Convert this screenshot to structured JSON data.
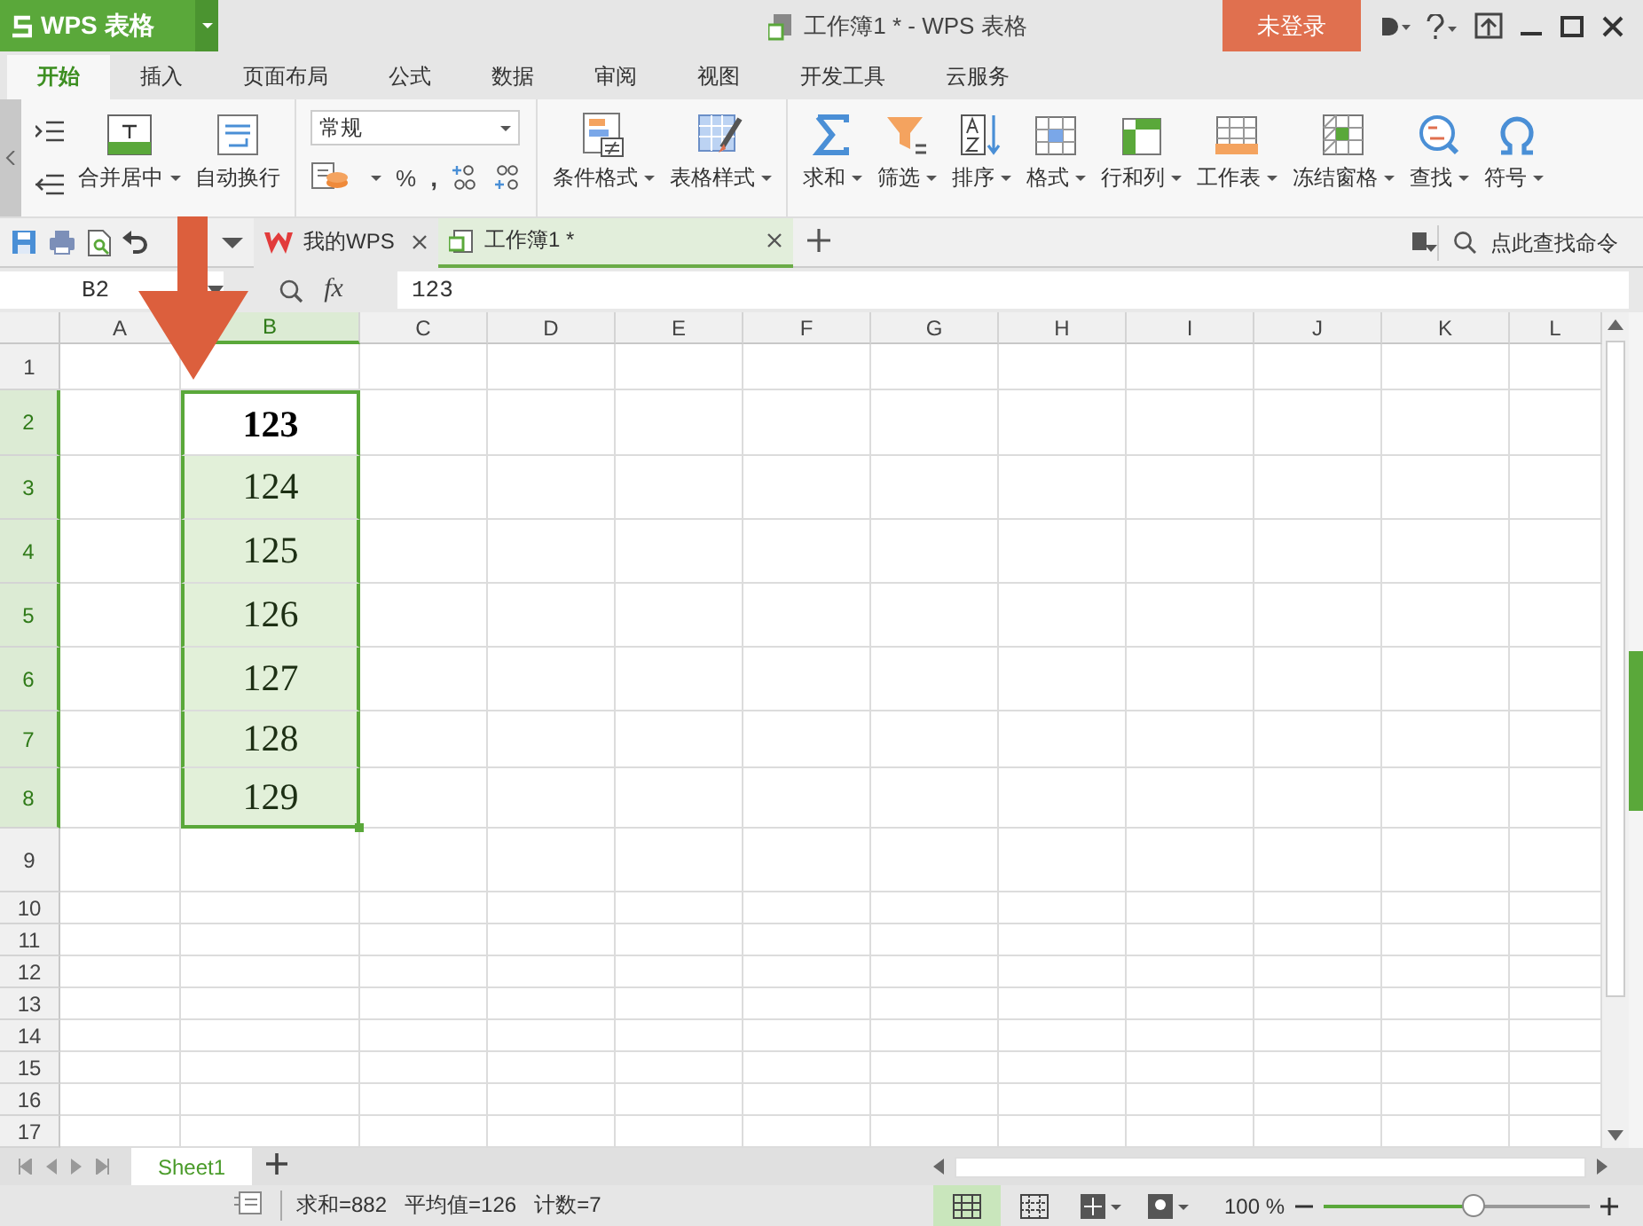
{
  "title_bar": {
    "app_button": "WPS 表格",
    "title": "工作簿1 * - WPS 表格",
    "login_button": "未登录"
  },
  "menu_tabs": [
    {
      "label": "开始",
      "selected": true
    },
    {
      "label": "插入",
      "selected": false
    },
    {
      "label": "页面布局",
      "selected": false
    },
    {
      "label": "公式",
      "selected": false
    },
    {
      "label": "数据",
      "selected": false
    },
    {
      "label": "审阅",
      "selected": false
    },
    {
      "label": "视图",
      "selected": false
    },
    {
      "label": "开发工具",
      "selected": false
    },
    {
      "label": "云服务",
      "selected": false
    }
  ],
  "ribbon": {
    "align_buttons": [
      {
        "label": "合并居中",
        "dropdown": true
      },
      {
        "label": "自动换行",
        "dropdown": false
      }
    ],
    "number_format": {
      "value": "常规",
      "percent": "%",
      "comma": ","
    },
    "style_buttons": [
      {
        "label": "条件格式",
        "dropdown": true
      },
      {
        "label": "表格样式",
        "dropdown": true
      }
    ],
    "tool_buttons": [
      {
        "label": "求和",
        "dropdown": true
      },
      {
        "label": "筛选",
        "dropdown": true
      },
      {
        "label": "排序",
        "dropdown": true
      },
      {
        "label": "格式",
        "dropdown": true
      },
      {
        "label": "行和列",
        "dropdown": true
      },
      {
        "label": "工作表",
        "dropdown": true
      },
      {
        "label": "冻结窗格",
        "dropdown": true
      },
      {
        "label": "查找",
        "dropdown": true
      },
      {
        "label": "符号",
        "dropdown": true
      }
    ]
  },
  "doc_tabs": [
    {
      "label": "我的WPS",
      "selected": false
    },
    {
      "label": "工作簿1 *",
      "selected": true
    }
  ],
  "command_search": {
    "placeholder": "点此查找命令"
  },
  "formula_bar": {
    "name_box": "B2",
    "fx": "fx",
    "value": "123"
  },
  "columns": [
    {
      "label": "A",
      "selected": false
    },
    {
      "label": "B",
      "selected": true
    },
    {
      "label": "C",
      "selected": false
    },
    {
      "label": "D",
      "selected": false
    },
    {
      "label": "E",
      "selected": false
    },
    {
      "label": "F",
      "selected": false
    },
    {
      "label": "G",
      "selected": false
    },
    {
      "label": "H",
      "selected": false
    },
    {
      "label": "I",
      "selected": false
    },
    {
      "label": "J",
      "selected": false
    },
    {
      "label": "K",
      "selected": false
    },
    {
      "label": "L",
      "selected": false
    }
  ],
  "rows": [
    {
      "label": "1",
      "selected": false
    },
    {
      "label": "2",
      "selected": true,
      "column_b": "123",
      "active": true
    },
    {
      "label": "3",
      "selected": true,
      "column_b": "124",
      "active": false
    },
    {
      "label": "4",
      "selected": true,
      "column_b": "125",
      "active": false
    },
    {
      "label": "5",
      "selected": true,
      "column_b": "126",
      "active": false
    },
    {
      "label": "6",
      "selected": true,
      "column_b": "127",
      "active": false
    },
    {
      "label": "7",
      "selected": true,
      "column_b": "128",
      "active": false
    },
    {
      "label": "8",
      "selected": true,
      "column_b": "129",
      "active": false
    },
    {
      "label": "9",
      "selected": false
    },
    {
      "label": "10",
      "selected": false
    },
    {
      "label": "11",
      "selected": false
    },
    {
      "label": "12",
      "selected": false
    },
    {
      "label": "13",
      "selected": false
    },
    {
      "label": "14",
      "selected": false
    },
    {
      "label": "15",
      "selected": false
    },
    {
      "label": "16",
      "selected": false
    },
    {
      "label": "17",
      "selected": false
    }
  ],
  "sheet_tabs": [
    {
      "label": "Sheet1",
      "selected": true
    }
  ],
  "status_bar": {
    "sum": "求和=882",
    "average": "平均值=126",
    "count": "计数=7",
    "zoom": "100 %",
    "zoom_level": {
      "level": 0.56
    }
  }
}
